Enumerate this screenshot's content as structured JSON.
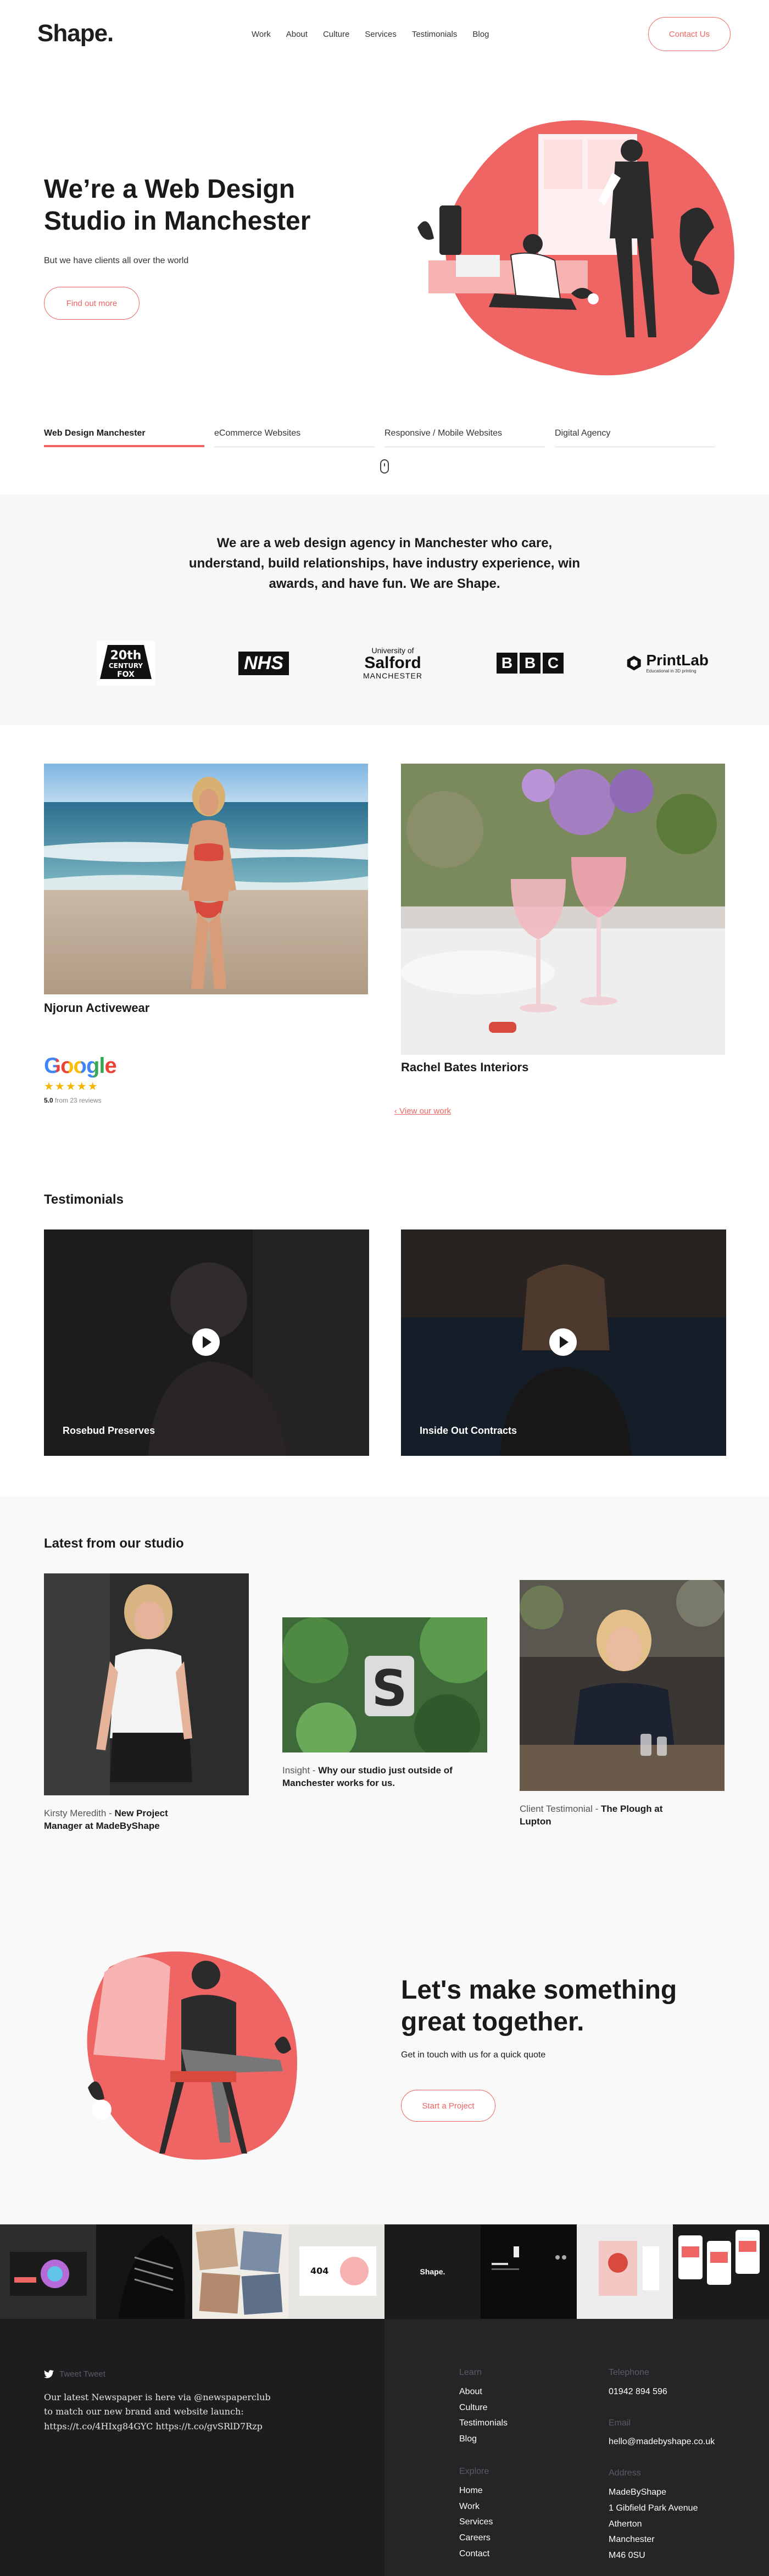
{
  "header": {
    "logo": "Shape.",
    "nav": [
      "Work",
      "About",
      "Culture",
      "Services",
      "Testimonials",
      "Blog"
    ],
    "contact_label": "Contact Us"
  },
  "hero": {
    "title": "We’re a Web Design Studio in Manchester",
    "subtitle": "But we have clients all over the world",
    "button_label": "Find out more",
    "tabs": [
      "Web Design Manchester",
      "eCommerce Websites",
      "Responsive / Mobile Websites",
      "Digital Agency"
    ]
  },
  "agency": {
    "text": "We are a web design agency in Manchester who care, understand, build relationships, have industry experience, win awards, and have fun. We are Shape.",
    "logos": {
      "fox_1": "20th",
      "fox_2": "CENTURY",
      "fox_3": "FOX",
      "nhs": "NHS",
      "salford_1": "University of",
      "salford_2": "Salford",
      "salford_3": "MANCHESTER",
      "bbc": [
        "B",
        "B",
        "C"
      ],
      "printlab": "PrintLab",
      "printlab_tag": "Educational in 3D printing"
    }
  },
  "work": {
    "project_1": "Njorun Activewear",
    "project_2": "Rachel Bates Interiors",
    "google_word": "Google",
    "stars": "★★★★★",
    "rating_score": "5.0",
    "rating_rest": " from 23 reviews",
    "view_work": "View our work"
  },
  "testimonials": {
    "title": "Testimonials",
    "videos": [
      "Rosebud Preserves",
      "Inside Out Contracts"
    ]
  },
  "studio": {
    "title": "Latest from our studio",
    "posts": [
      {
        "category": "Kirsty Meredith - ",
        "title": "New Project Manager at MadeByShape"
      },
      {
        "category": "Insight - ",
        "title": "Why our studio just outside of Manchester works for us."
      },
      {
        "category": "Client Testimonial - ",
        "title": "The Plough at Lupton"
      }
    ]
  },
  "cta": {
    "title": "Let's make something great together.",
    "subtitle": "Get in touch with us for a quick quote",
    "button_label": "Start a Project"
  },
  "gallery": {
    "swatch_label": "404",
    "shape_label": "Shape."
  },
  "footer": {
    "tweet_heading": "Tweet Tweet",
    "tweet_text": "Our latest Newspaper is here via @newspaperclub to match our new brand and website launch: https://t.co/4HIxg84GYC https://t.co/gvSRlD7Rzp",
    "learn_heading": "Learn",
    "learn_links": [
      "About",
      "Culture",
      "Testimonials",
      "Blog"
    ],
    "explore_heading": "Explore",
    "explore_links": [
      "Home",
      "Work",
      "Services",
      "Careers",
      "Contact"
    ],
    "telephone_heading": "Telephone",
    "telephone": "01942 894 596",
    "email_heading": "Email",
    "email": "hello@madebyshape.co.uk",
    "address_heading": "Address",
    "address_lines": [
      "MadeByShape",
      "1 Gibfield Park Avenue",
      "Atherton",
      "Manchester",
      "M46 0SU"
    ]
  },
  "colors": {
    "accent": "#ee6563",
    "footer_dark": "#1d1d20",
    "band_grey": "#f7f7f7",
    "star": "#f5b400"
  }
}
